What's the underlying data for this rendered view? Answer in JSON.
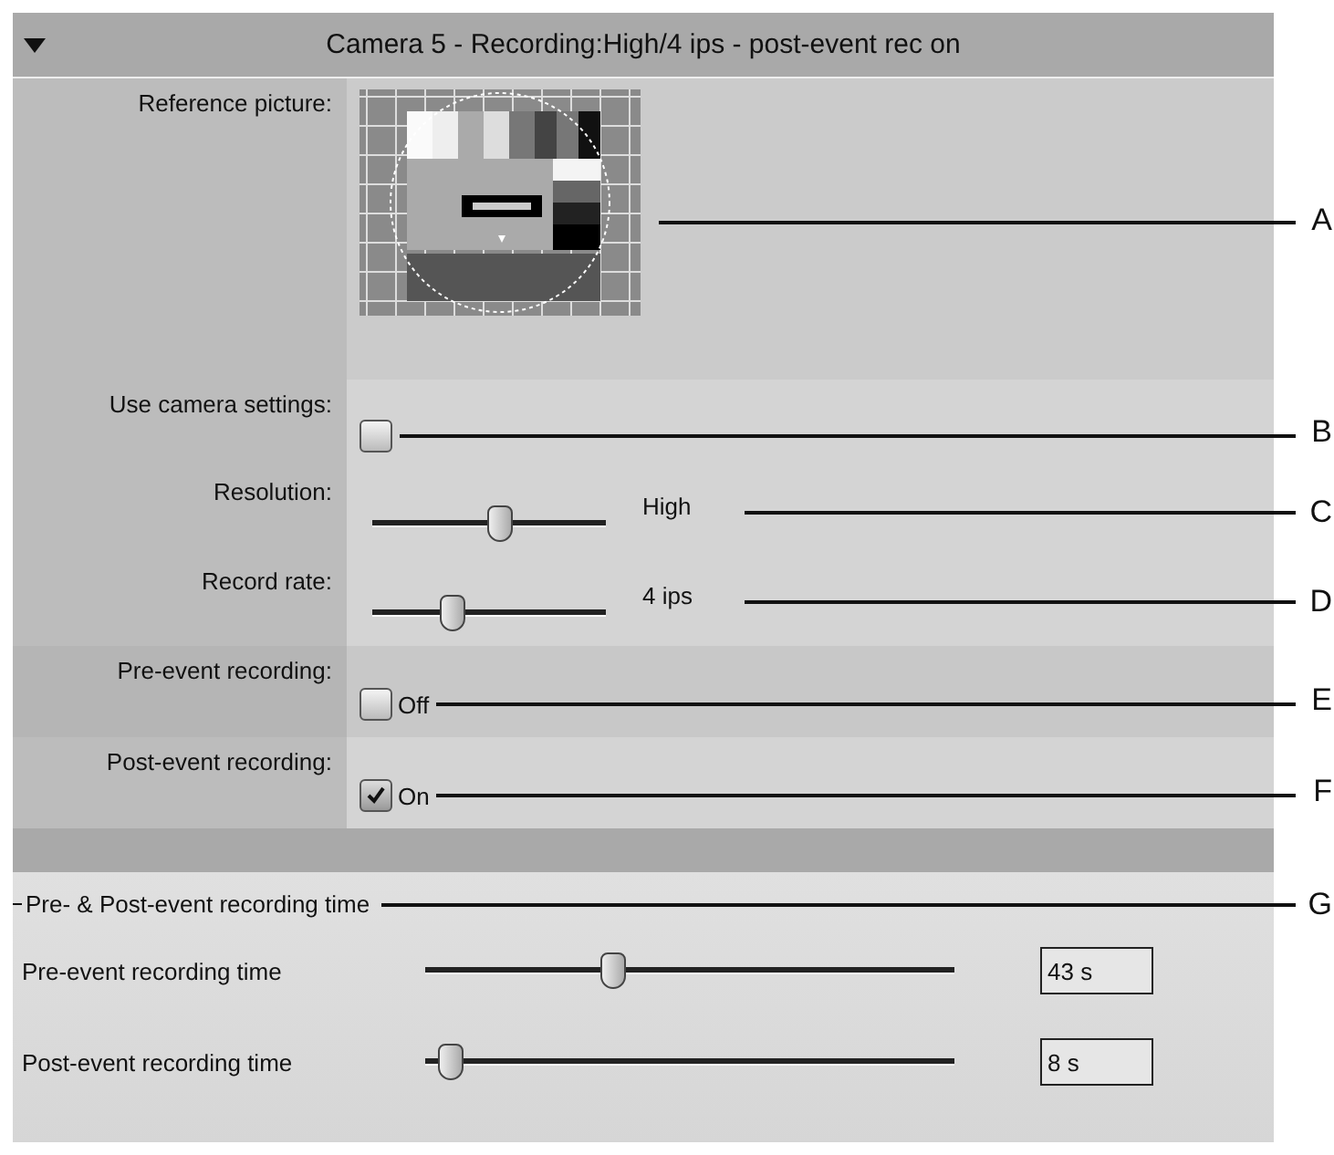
{
  "header": {
    "title": "Camera 5 - Recording:High/4 ips - post-event rec on",
    "expanded": true
  },
  "settings": [
    {
      "kind": "picture",
      "label": "Reference picture:",
      "callout": "A"
    },
    {
      "kind": "checkbox",
      "label": "Use camera settings:",
      "checked": false,
      "callout": "B"
    },
    {
      "kind": "slider",
      "label": "Resolution:",
      "level": 0.49,
      "reading": "High",
      "callout": "C"
    },
    {
      "kind": "slider",
      "label": "Record rate:",
      "level": 0.31,
      "reading": "4 ips",
      "callout": "D"
    },
    {
      "kind": "checkbox",
      "label": "Pre-event recording:",
      "checked": false,
      "text": "Off",
      "callout": "E"
    },
    {
      "kind": "checkbox",
      "label": "Post-event recording:",
      "checked": true,
      "text": "On",
      "callout": "F"
    }
  ],
  "group": {
    "title": "Pre- & Post-event recording time",
    "callout": "G",
    "rows": [
      {
        "label": "Pre-event recording time",
        "level": 0.34,
        "value": "43 s"
      },
      {
        "label": "Post-event recording time",
        "level": 0.045,
        "value": "8 s"
      }
    ]
  }
}
